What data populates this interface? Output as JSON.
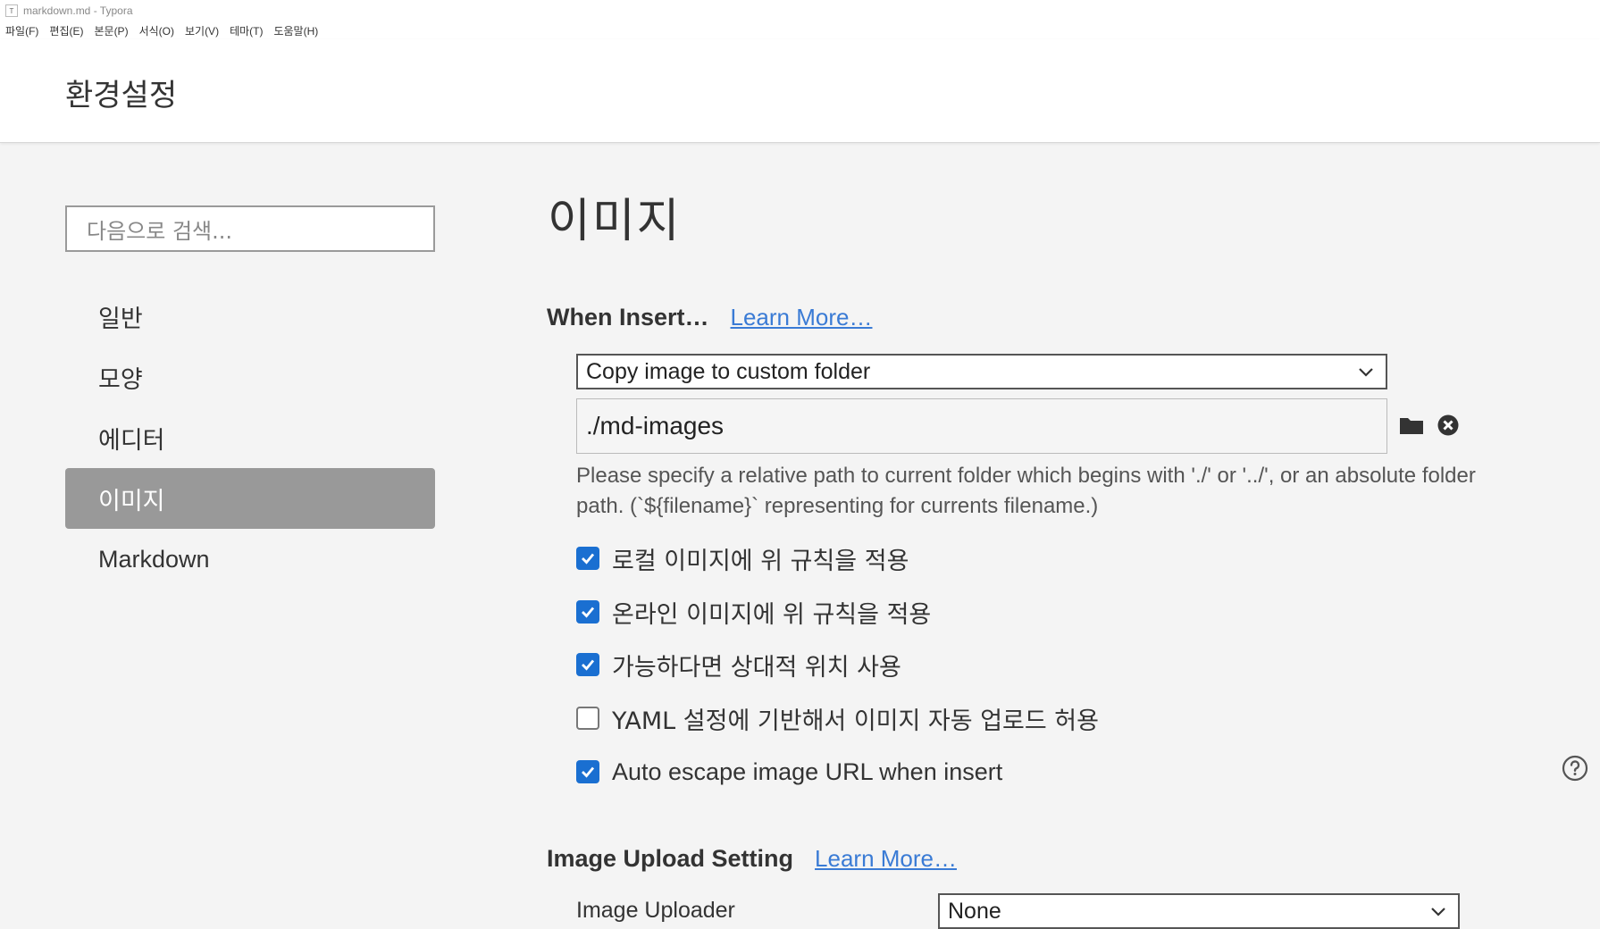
{
  "window": {
    "title": "markdown.md - Typora",
    "app_icon": "T"
  },
  "menu": [
    "파일(F)",
    "편집(E)",
    "본문(P)",
    "서식(O)",
    "보기(V)",
    "테마(T)",
    "도움말(H)"
  ],
  "header": {
    "title": "환경설정"
  },
  "sidebar": {
    "search_placeholder": "다음으로 검색...",
    "items": [
      {
        "label": "일반",
        "active": false
      },
      {
        "label": "모양",
        "active": false
      },
      {
        "label": "에디터",
        "active": false
      },
      {
        "label": "이미지",
        "active": true
      },
      {
        "label": "Markdown",
        "active": false
      }
    ]
  },
  "main": {
    "title": "이미지",
    "when_insert": {
      "heading": "When Insert…",
      "learn_more": "Learn More…",
      "select_value": "Copy image to custom folder",
      "path_value": "./md-images",
      "hint": " Please specify a relative path to current folder which begins with './' or '../', or an absolute folder path. (`${filename}` representing for currents filename.)"
    },
    "options": [
      {
        "label": "로컬 이미지에 위 규칙을 적용",
        "checked": true
      },
      {
        "label": "온라인 이미지에 위 규칙을 적용",
        "checked": true
      },
      {
        "label": "가능하다면 상대적 위치 사용",
        "checked": true
      },
      {
        "label": "YAML 설정에 기반해서 이미지 자동 업로드 허용",
        "checked": false
      },
      {
        "label": "Auto escape image URL when insert",
        "checked": true
      }
    ],
    "upload": {
      "heading": "Image Upload Setting",
      "learn_more": "Learn More…",
      "uploader_label": "Image Uploader",
      "uploader_value": "None"
    }
  },
  "colors": {
    "accent": "#1a6fd1",
    "active_nav": "#999999",
    "link": "#3a7bd5"
  }
}
